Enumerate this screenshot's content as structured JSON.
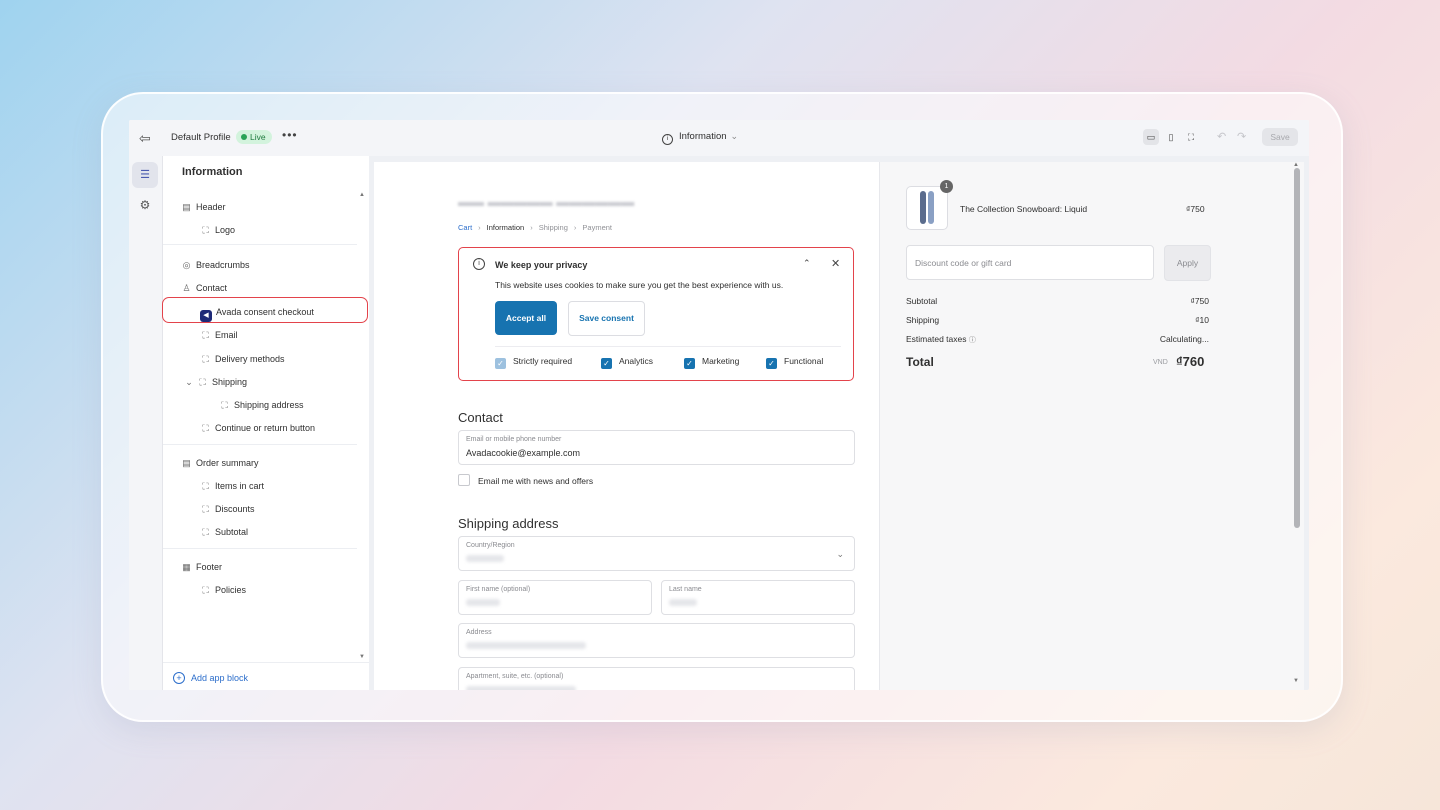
{
  "topbar": {
    "profile": "Default Profile",
    "live": "Live",
    "more": "•••",
    "page": "Information",
    "save": "Save"
  },
  "sidebar": {
    "title": "Information",
    "items": {
      "header": "Header",
      "logo": "Logo",
      "breadcrumbs": "Breadcrumbs",
      "contact": "Contact",
      "avada": "Avada consent checkout",
      "email": "Email",
      "delivery": "Delivery methods",
      "shipping": "Shipping",
      "shipping_address": "Shipping address",
      "continue": "Continue or return button",
      "order_summary": "Order summary",
      "items_in_cart": "Items in cart",
      "discounts": "Discounts",
      "subtotal": "Subtotal",
      "footer": "Footer",
      "policies": "Policies"
    },
    "add_app_block": "Add app block"
  },
  "checkout": {
    "breadcrumbs": [
      "Cart",
      "Information",
      "Shipping",
      "Payment"
    ],
    "consent": {
      "title": "We keep your privacy",
      "text": "This website uses cookies to make sure you get the best experience with us.",
      "accept_all": "Accept all",
      "save_consent": "Save consent",
      "options": [
        "Strictly required",
        "Analytics",
        "Marketing",
        "Functional"
      ]
    },
    "contact": {
      "title": "Contact",
      "email_label": "Email or mobile phone number",
      "email_value": "Avadacookie@example.com",
      "newsletter": "Email me with news and offers"
    },
    "shipping": {
      "title": "Shipping address",
      "country_label": "Country/Region",
      "first_name_label": "First name (optional)",
      "last_name_label": "Last name",
      "address_label": "Address",
      "apartment_label": "Apartment, suite, etc. (optional)"
    }
  },
  "summary": {
    "qty": "1",
    "product_name": "The Collection Snowboard: Liquid",
    "product_price": "₫750",
    "discount_placeholder": "Discount code or gift card",
    "apply": "Apply",
    "subtotal_label": "Subtotal",
    "subtotal_value": "₫750",
    "shipping_label": "Shipping",
    "shipping_value": "₫10",
    "taxes_label": "Estimated taxes",
    "taxes_value": "Calculating...",
    "total_label": "Total",
    "currency": "VND",
    "total_value": "₫760"
  },
  "colors": {
    "accent": "#1773b0",
    "highlight": "#e3434b",
    "live": "#29a356"
  }
}
